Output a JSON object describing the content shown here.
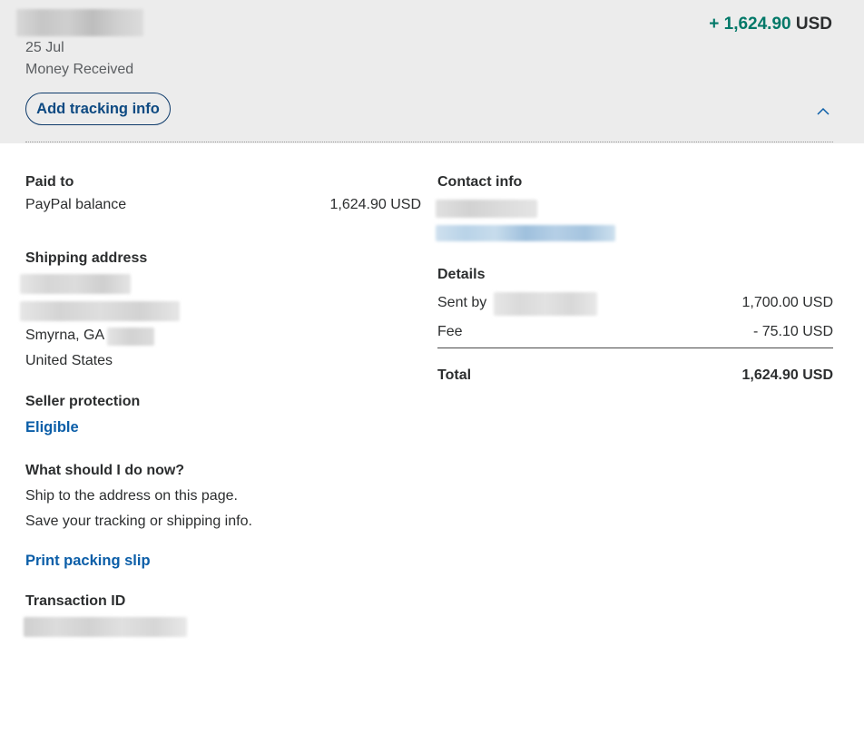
{
  "header": {
    "date": "25 Jul",
    "status": "Money Received",
    "amount_sign_value": "+ 1,624.90",
    "amount_currency": "USD",
    "tracking_button": "Add tracking info",
    "collapse_icon": "chevron-up-icon"
  },
  "paid_to": {
    "label": "Paid to",
    "method": "PayPal balance",
    "amount": "1,624.90 USD"
  },
  "shipping": {
    "label": "Shipping address",
    "city_state": "Smyrna, GA",
    "country": "United States"
  },
  "seller_protection": {
    "label": "Seller protection",
    "value": "Eligible"
  },
  "next_steps": {
    "label": "What should I do now?",
    "line1": "Ship to the address on this page.",
    "line2": "Save your tracking or shipping info."
  },
  "print_link": "Print packing slip",
  "transaction": {
    "label": "Transaction ID"
  },
  "contact": {
    "label": "Contact info"
  },
  "details": {
    "label": "Details",
    "sent_by_label": "Sent by",
    "sent_by_amount": "1,700.00 USD",
    "fee_label": "Fee",
    "fee_amount": "- 75.10 USD",
    "total_label": "Total",
    "total_amount": "1,624.90 USD"
  },
  "colors": {
    "amount_green": "#017868",
    "link_blue": "#0b5ea8",
    "header_bg": "#ececec"
  }
}
